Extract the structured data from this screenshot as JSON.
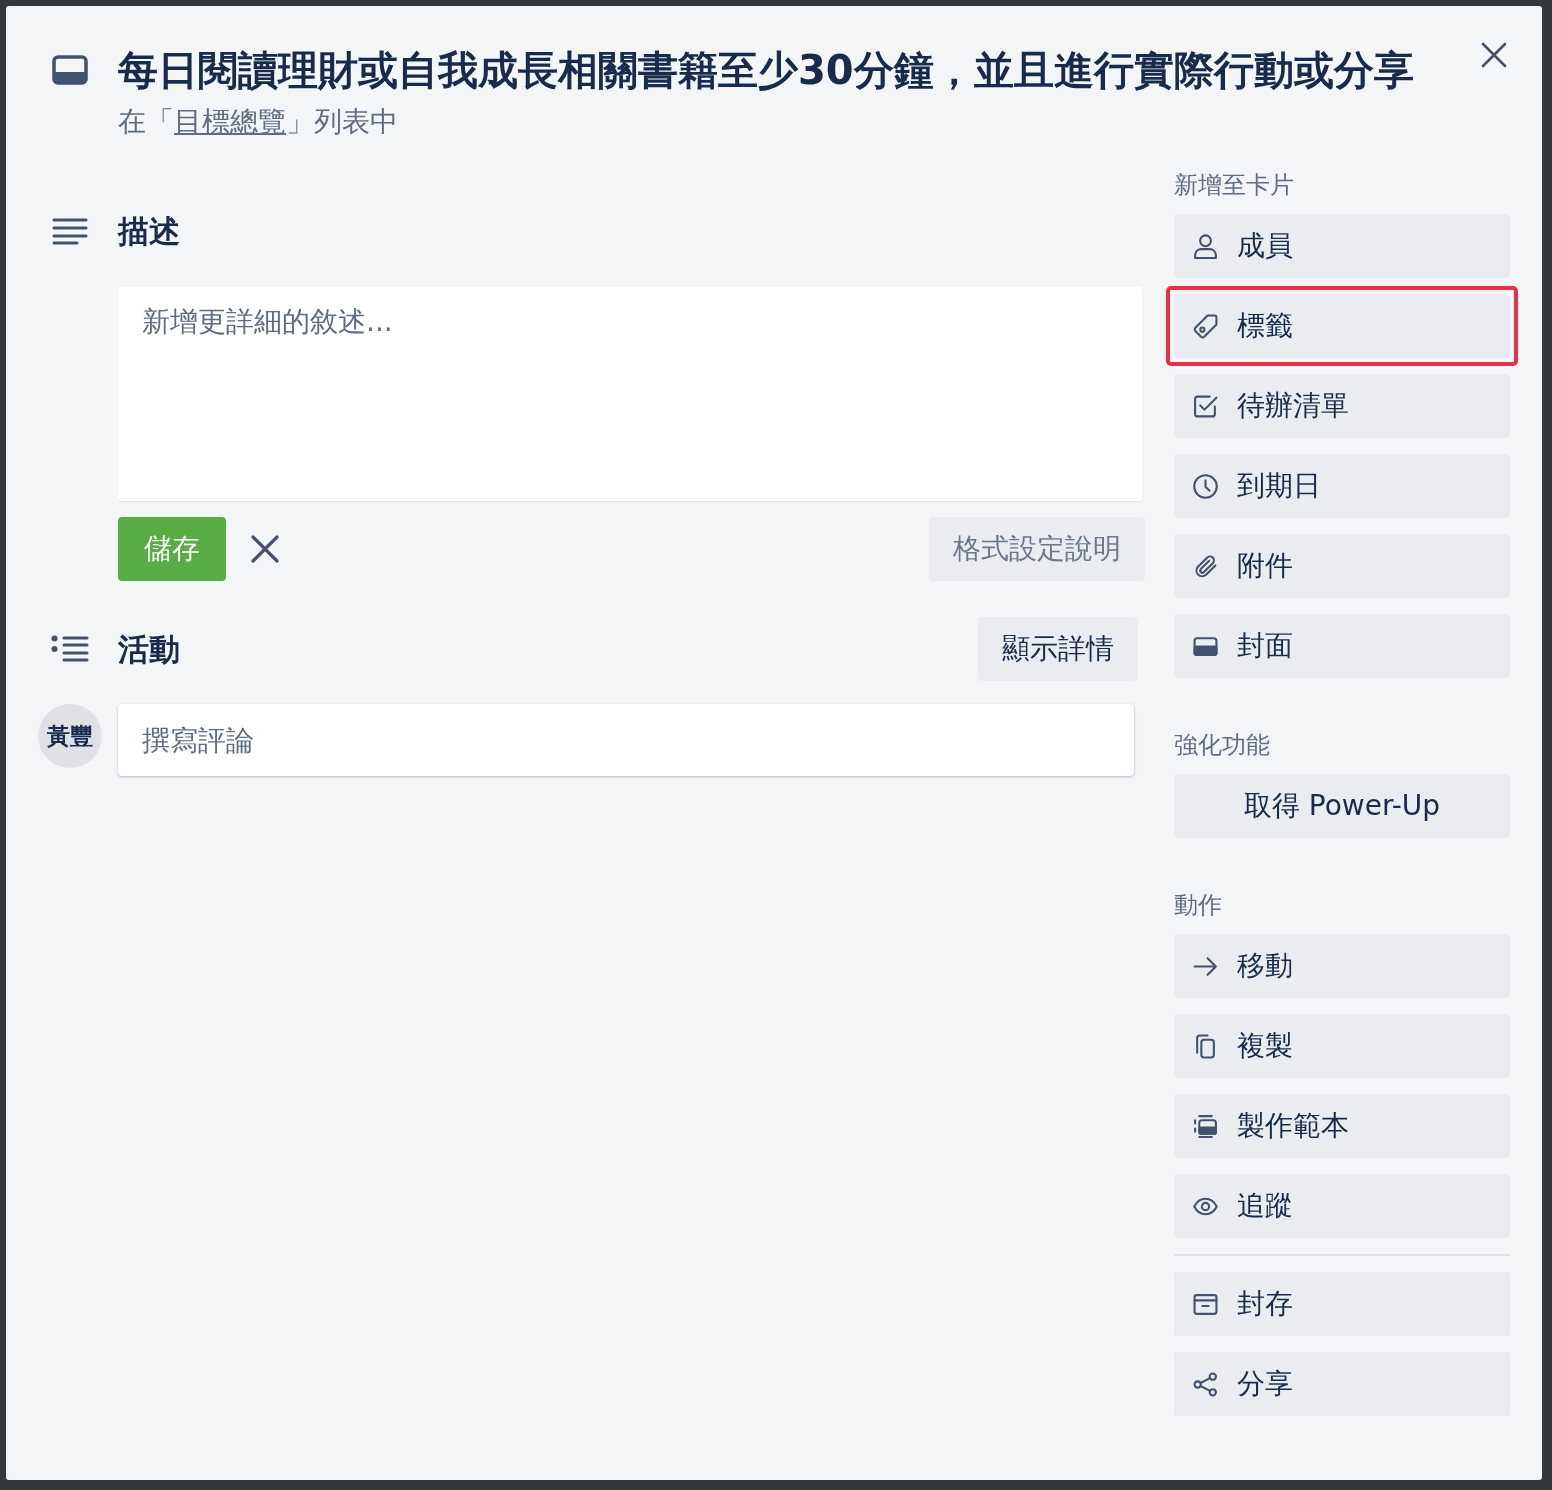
{
  "card": {
    "title": "每日閱讀理財或自我成長相關書籍至少30分鐘，並且進行實際行動或分享",
    "location": {
      "before": "在「",
      "link": "目標總覽",
      "after": "」列表中"
    }
  },
  "description": {
    "heading": "描述",
    "placeholder": "新增更詳細的敘述...",
    "save_label": "儲存",
    "help_label": "格式設定說明"
  },
  "activity": {
    "heading": "活動",
    "details_label": "顯示詳情",
    "avatar_initials": "黃豐",
    "comment_placeholder": "撰寫評論"
  },
  "sidebar": {
    "sections": [
      {
        "heading": "新增至卡片",
        "groups": [
          [
            {
              "label": "成員",
              "kind": "icon",
              "highlighted": false
            },
            {
              "label": "標籤",
              "kind": "icon",
              "highlighted": true
            },
            {
              "label": "待辦清單",
              "kind": "icon",
              "highlighted": false
            },
            {
              "label": "到期日",
              "kind": "icon",
              "highlighted": false
            },
            {
              "label": "附件",
              "kind": "icon",
              "highlighted": false
            },
            {
              "label": "封面",
              "kind": "icon",
              "highlighted": false
            }
          ]
        ]
      },
      {
        "heading": "強化功能",
        "groups": [
          [
            {
              "label": "取得 Power-Up",
              "kind": "text",
              "highlighted": false
            }
          ]
        ]
      },
      {
        "heading": "動作",
        "groups": [
          [
            {
              "label": "移動",
              "kind": "icon",
              "highlighted": false
            },
            {
              "label": "複製",
              "kind": "icon",
              "highlighted": false
            },
            {
              "label": "製作範本",
              "kind": "icon",
              "highlighted": false
            },
            {
              "label": "追蹤",
              "kind": "icon",
              "highlighted": false
            }
          ],
          [
            {
              "label": "封存",
              "kind": "icon",
              "highlighted": false
            },
            {
              "label": "分享",
              "kind": "icon",
              "highlighted": false
            }
          ]
        ]
      }
    ]
  }
}
